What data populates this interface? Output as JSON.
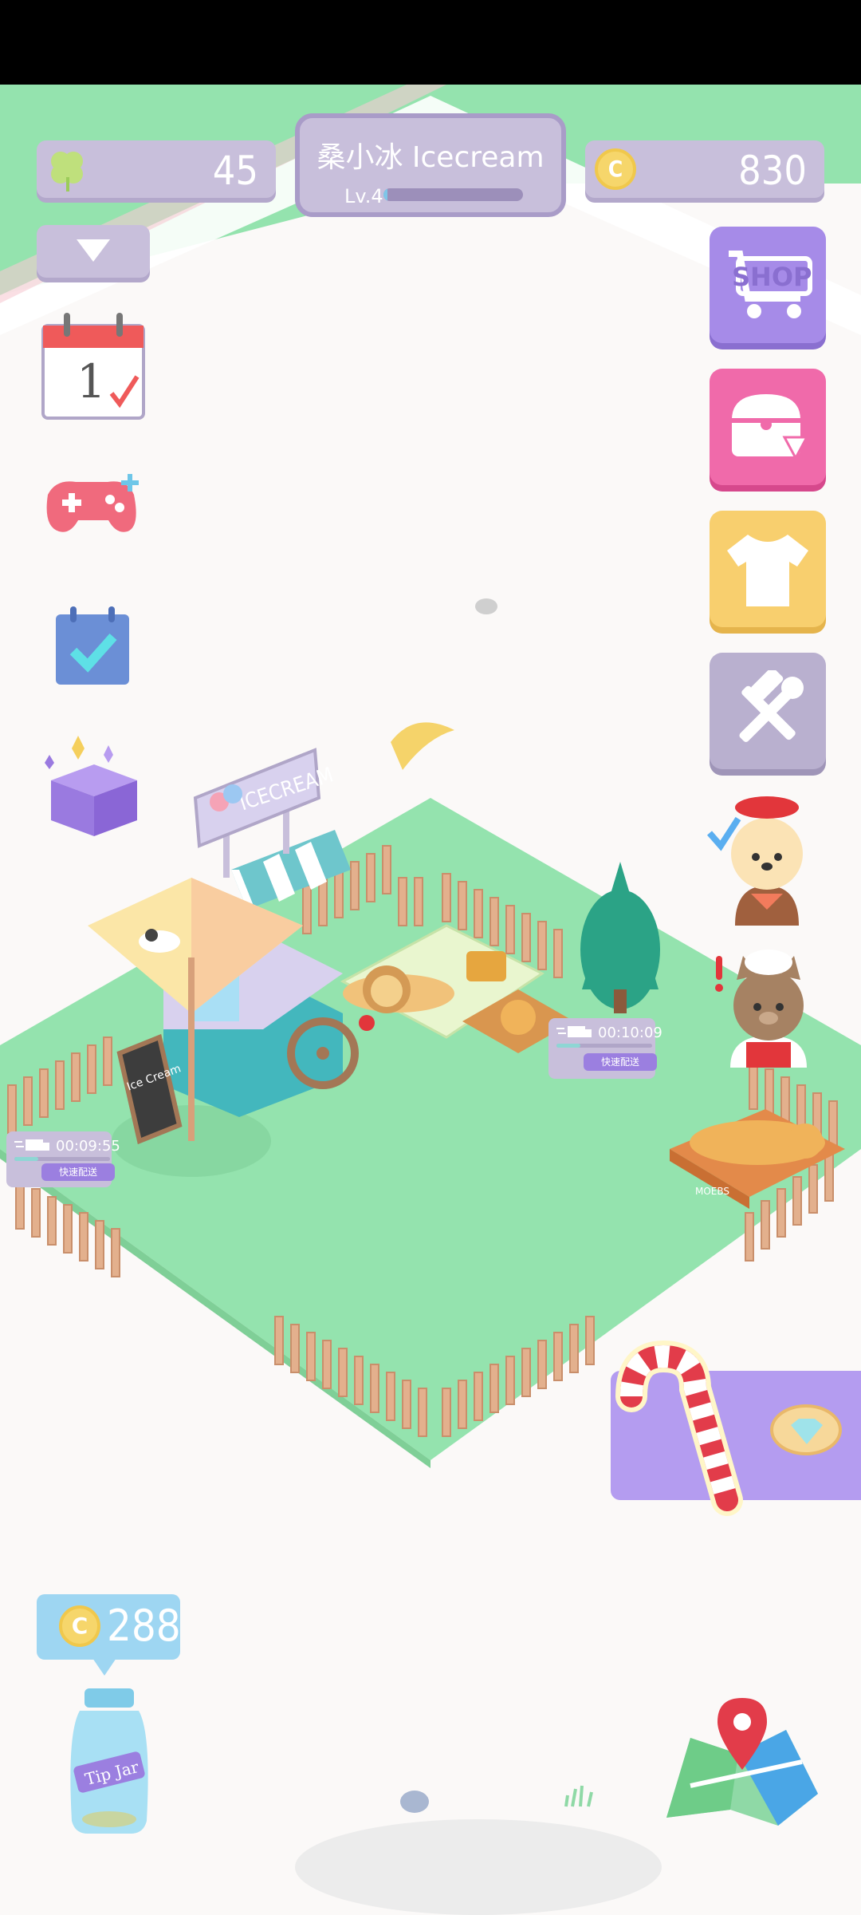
{
  "hud": {
    "clover_count": "45",
    "coin_count": "830",
    "player_name": "桑小冰 Icecream",
    "level_label": "Lv.4",
    "level_progress": 0.03
  },
  "right_menu": {
    "shop_label": "SHOP"
  },
  "left_menu": {
    "calendar_day": "1"
  },
  "scene": {
    "sign_text": "ICECREAM",
    "chalkboard_text": "Ice Cream"
  },
  "timers": {
    "delivery_1": {
      "time": "00:09:55",
      "button": "快速配送",
      "progress": 0.25
    },
    "delivery_2": {
      "time": "00:10:09",
      "button": "快速配送",
      "progress": 0.25
    }
  },
  "tip_jar": {
    "coins": "288",
    "label": "Tip Jar"
  },
  "pet_bed_label": "MOEBS",
  "colors": {
    "grass": "#94e3ae",
    "lavender_panel": "#c8bfdb",
    "shop_button": "#a68be8",
    "chest_button": "#f06aaa",
    "wardrobe_button": "#f8cf6e",
    "build_button": "#b9b0cf",
    "event_panel": "#b49cf0"
  }
}
